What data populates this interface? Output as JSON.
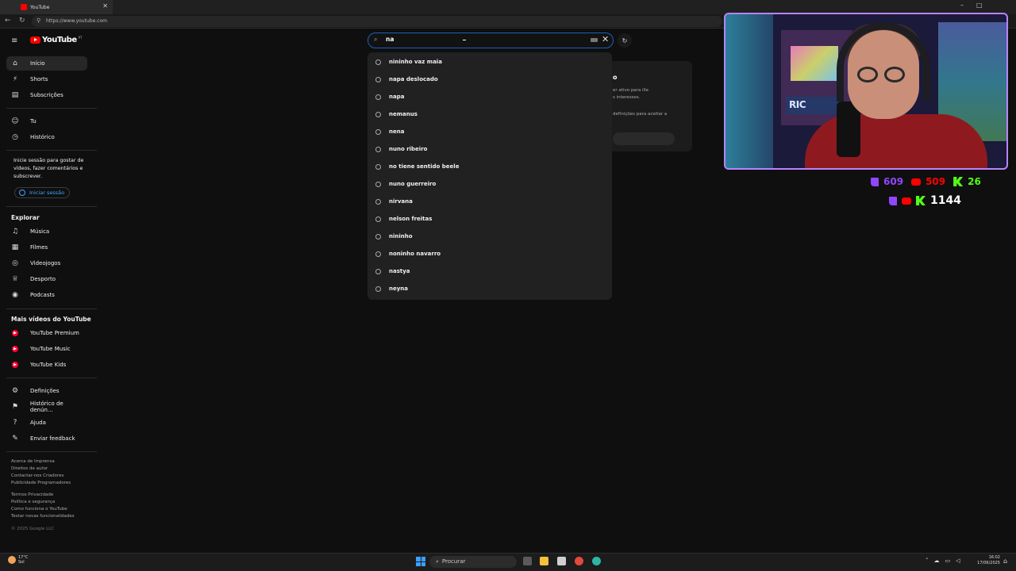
{
  "browser": {
    "tab_title": "YouTube",
    "url": "https://www.youtube.com"
  },
  "header": {
    "logo_text": "YouTube",
    "region": "PT"
  },
  "sidebar": {
    "main_items": [
      {
        "label": "Início",
        "icon": "home-icon"
      },
      {
        "label": "Shorts",
        "icon": "shorts-icon"
      },
      {
        "label": "Subscrições",
        "icon": "subscriptions-icon"
      }
    ],
    "you_items": [
      {
        "label": "Tu",
        "icon": "you-icon"
      },
      {
        "label": "Histórico",
        "icon": "history-icon"
      }
    ],
    "signin_text": "Inicie sessão para gostar de vídeos, fazer comentários e subscrever.",
    "signin_button": "Iniciar sessão",
    "explore_heading": "Explorar",
    "explore_items": [
      {
        "label": "Música",
        "icon": "music-icon"
      },
      {
        "label": "Filmes",
        "icon": "movies-icon"
      },
      {
        "label": "Videojogos",
        "icon": "gaming-icon"
      },
      {
        "label": "Desporto",
        "icon": "sports-icon"
      },
      {
        "label": "Podcasts",
        "icon": "podcasts-icon"
      }
    ],
    "more_heading": "Mais vídeos do YouTube",
    "more_items": [
      {
        "label": "YouTube Premium",
        "icon": "youtube-premium-icon"
      },
      {
        "label": "YouTube Music",
        "icon": "youtube-music-icon"
      },
      {
        "label": "YouTube Kids",
        "icon": "youtube-kids-icon"
      }
    ],
    "settings_items": [
      {
        "label": "Definições",
        "icon": "settings-icon"
      },
      {
        "label": "Histórico de denún...",
        "icon": "flag-icon"
      },
      {
        "label": "Ajuda",
        "icon": "help-icon"
      },
      {
        "label": "Enviar feedback",
        "icon": "feedback-icon"
      }
    ],
    "footer_lines": [
      "Acerca de  Imprensa",
      "Direitos de autor",
      "Contactar-nos  Criadores",
      "Publicidade  Programadores",
      "Termos  Privacidade",
      "Política e segurança",
      "Como funciona o YouTube",
      "Testar novas funcionalidades"
    ],
    "copyright": "© 2025 Google LLC"
  },
  "search": {
    "value": "na",
    "suggestions": [
      "nininho vaz maia",
      "napa deslocado",
      "napa",
      "nemanus",
      "nena",
      "nuno ribeiro",
      "no tiene sentido beele",
      "nuno guerreiro",
      "nirvana",
      "nelson freitas",
      "nininho",
      "noninho navarro",
      "nastya",
      "neyna"
    ]
  },
  "background_card": {
    "title": "o",
    "lines": [
      "er ativo para ille",
      "s interesses.",
      "",
      "definições para aceitar a"
    ]
  },
  "stream_stats": {
    "twitch": "609",
    "youtube": "509",
    "kick": "26",
    "total": "1144",
    "colors": {
      "twitch": "#9146ff",
      "youtube": "#ff0000",
      "kick": "#53fc18",
      "total": "#ffffff"
    }
  },
  "webcam": {
    "sign_text": "RIC"
  },
  "taskbar": {
    "weather_temp": "17°C",
    "weather_desc": "Sol",
    "search_placeholder": "Procurar",
    "time": "16:02",
    "date": "17/06/2025"
  }
}
